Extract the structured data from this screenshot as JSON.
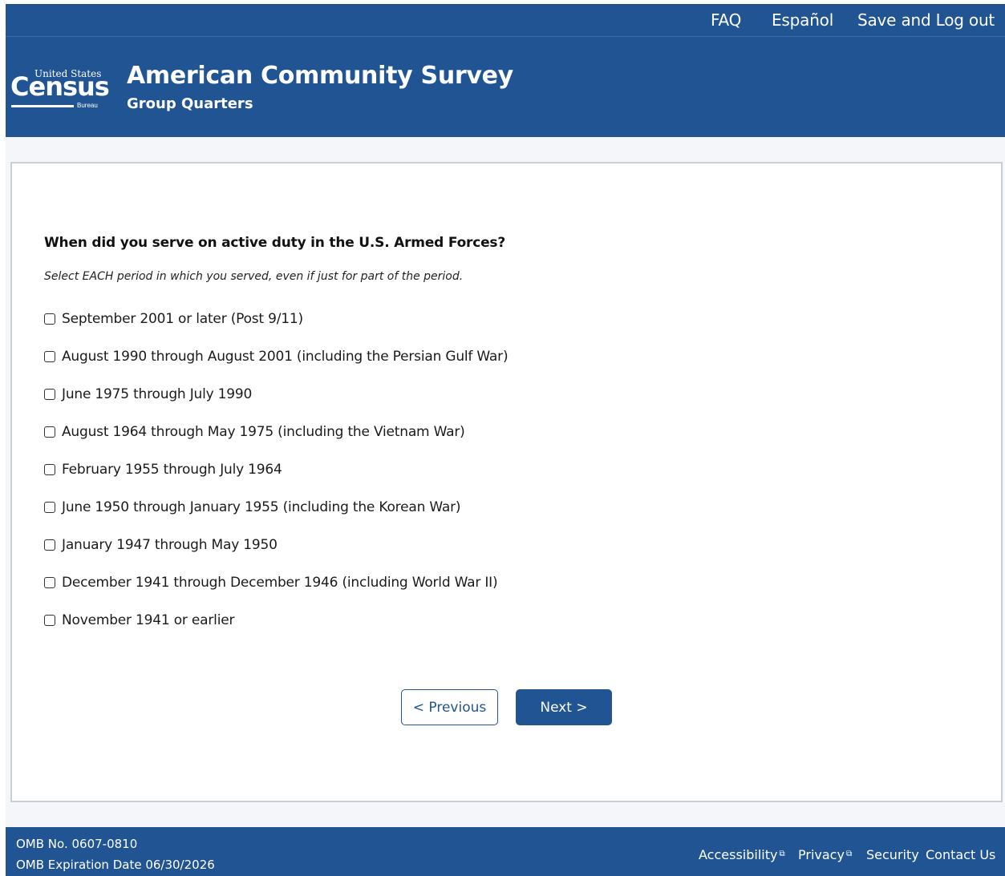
{
  "header": {
    "util_nav": {
      "faq": "FAQ",
      "espanol": "Español",
      "save_logout": "Save and Log out"
    },
    "logo": {
      "top_text": "United States",
      "main_text": "Census",
      "bottom_text": "Bureau"
    },
    "title": "American Community Survey",
    "subtitle": "Group Quarters"
  },
  "question": {
    "text": "When did you serve on active duty in the U.S. Armed Forces?",
    "instruction": "Select EACH period in which you served, even if just for part of the period.",
    "options": [
      {
        "label": "September 2001 or later (Post 9/11)",
        "checked": false
      },
      {
        "label": "August 1990 through August 2001 (including the Persian Gulf War)",
        "checked": false
      },
      {
        "label": "June 1975 through July 1990",
        "checked": false
      },
      {
        "label": "August 1964 through May 1975 (including the Vietnam War)",
        "checked": false
      },
      {
        "label": "February 1955 through July 1964",
        "checked": false
      },
      {
        "label": "June 1950 through January 1955 (including the Korean War)",
        "checked": false
      },
      {
        "label": "January 1947 through May 1950",
        "checked": false
      },
      {
        "label": "December 1941 through December 1946 (including World War II)",
        "checked": false
      },
      {
        "label": "November 1941 or earlier",
        "checked": false
      }
    ]
  },
  "nav": {
    "previous": "< Previous",
    "next": "Next >"
  },
  "footer": {
    "omb_number": "OMB No. 0607-0810",
    "omb_expiration": "OMB Expiration Date 06/30/2026",
    "links": {
      "accessibility": "Accessibility",
      "privacy": "Privacy",
      "security": "Security",
      "contact": "Contact Us"
    }
  },
  "colors": {
    "primary": "#205493",
    "page_bg": "#f4f6f9",
    "card_border": "#c9cfd6"
  },
  "icons": {
    "external_link": "external-link-icon"
  }
}
